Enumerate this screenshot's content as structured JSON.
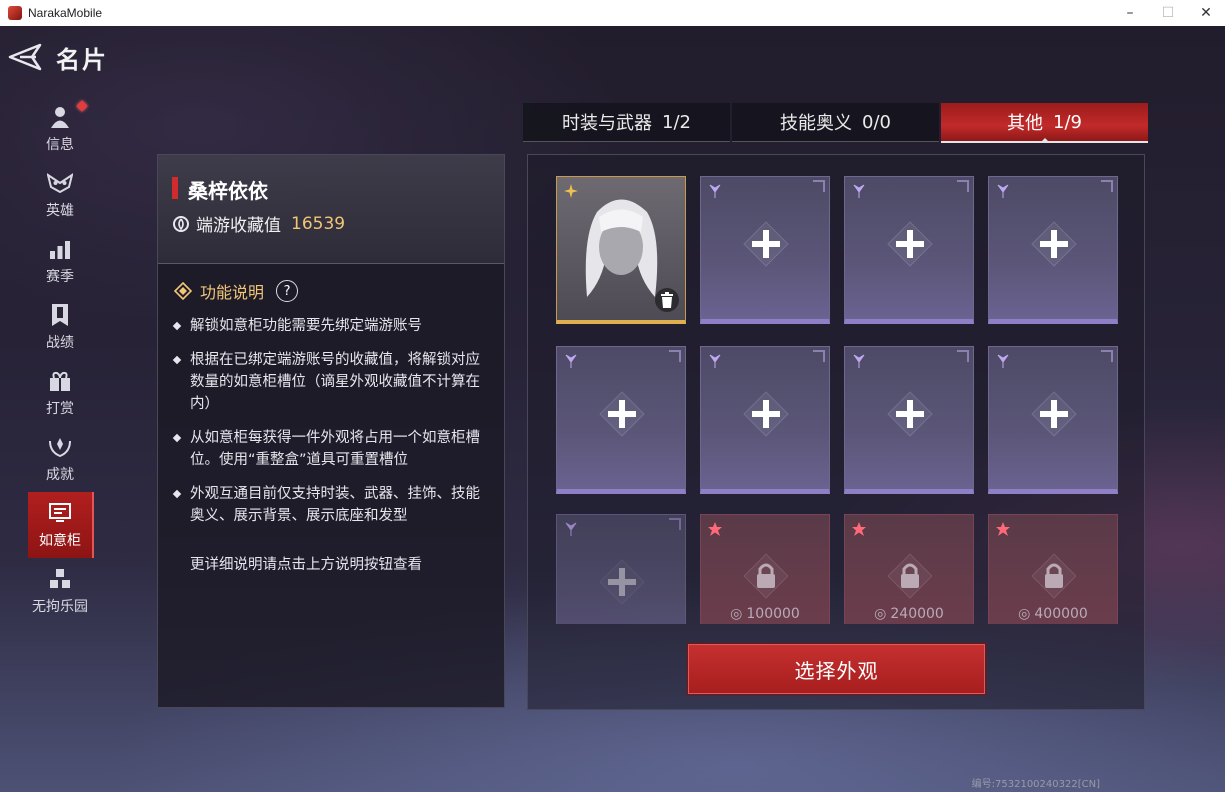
{
  "window": {
    "title": "NarakaMobile",
    "min": "–",
    "max": "☐",
    "close": "✕"
  },
  "page": {
    "title": "名片"
  },
  "nav": [
    {
      "label": "信息",
      "icon": "info-figure-icon",
      "badge": true
    },
    {
      "label": "英雄",
      "icon": "hero-mask-icon"
    },
    {
      "label": "赛季",
      "icon": "season-bars-icon"
    },
    {
      "label": "战绩",
      "icon": "record-banner-icon"
    },
    {
      "label": "打赏",
      "icon": "reward-gift-icon"
    },
    {
      "label": "成就",
      "icon": "achievement-laurel-icon"
    },
    {
      "label": "如意柜",
      "icon": "cabinet-monitor-icon",
      "active": true
    },
    {
      "label": "无拘乐园",
      "icon": "playground-cubes-icon"
    }
  ],
  "profile": {
    "name": "桑梓依依",
    "collection_label": "端游收藏值",
    "collection_value": "16539"
  },
  "help": {
    "title": "功能说明",
    "q": "?",
    "bullets": [
      "解锁如意柜功能需要先绑定端游账号",
      "根据在已绑定端游账号的收藏值，将解锁对应数量的如意柜槽位（谪星外观收藏值不计算在内）",
      "从如意柜每获得一件外观将占用一个如意柜槽位。使用“重整盒”道具可重置槽位",
      "外观互通目前仅支持时装、武器、挂饰、技能奥义、展示背景、展示底座和发型"
    ],
    "more": "更详细说明请点击上方说明按钮查看"
  },
  "tabs": [
    {
      "label": "时装与武器",
      "count": "1/2"
    },
    {
      "label": "技能奥义",
      "count": "0/0"
    },
    {
      "label": "其他",
      "count": "1/9",
      "active": true
    }
  ],
  "locked_slots": [
    {
      "value": "100000"
    },
    {
      "value": "240000"
    },
    {
      "value": "400000"
    }
  ],
  "actions": {
    "select_label": "选择外观"
  },
  "footer": {
    "id": "编号:7532100240322[CN]"
  },
  "colors": {
    "accent_red": "#c22a2a",
    "gold": "#f2c577",
    "slot_purple": "#8e7fc6"
  }
}
